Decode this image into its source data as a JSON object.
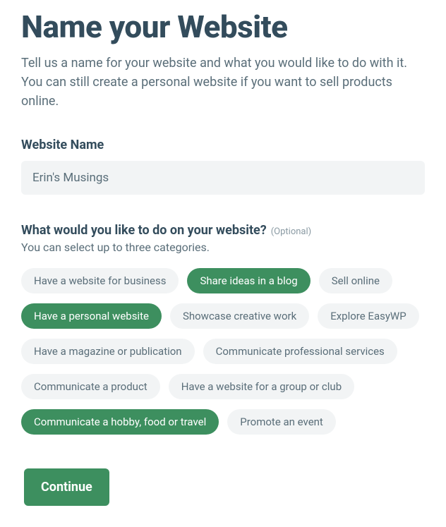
{
  "header": {
    "title": "Name your Website",
    "subtitle": "Tell us a name for your website and what you would like to do with it. You can still create a personal website if you want to sell products online."
  },
  "name_field": {
    "label": "Website Name",
    "value": "Erin's Musings"
  },
  "categories": {
    "question": "What would you like to do on your website?",
    "optional": "(Optional)",
    "helper": "You can select up to three categories.",
    "options": [
      {
        "label": "Have a website for business",
        "selected": false
      },
      {
        "label": "Share ideas in a blog",
        "selected": true
      },
      {
        "label": "Sell online",
        "selected": false
      },
      {
        "label": "Have a personal website",
        "selected": true
      },
      {
        "label": "Showcase creative work",
        "selected": false
      },
      {
        "label": "Explore EasyWP",
        "selected": false
      },
      {
        "label": "Have a magazine or publication",
        "selected": false
      },
      {
        "label": "Communicate professional services",
        "selected": false
      },
      {
        "label": "Communicate a product",
        "selected": false
      },
      {
        "label": "Have a website for a group or club",
        "selected": false
      },
      {
        "label": "Communicate a hobby, food or travel",
        "selected": true
      },
      {
        "label": "Promote an event",
        "selected": false
      }
    ]
  },
  "actions": {
    "continue": "Continue"
  }
}
